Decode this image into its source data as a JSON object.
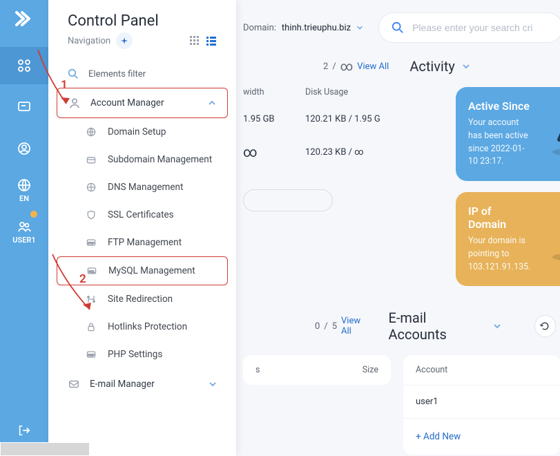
{
  "iconbar": {
    "lang": "EN",
    "user": "USER1"
  },
  "nav": {
    "title": "Control Panel",
    "subtitle": "Navigation",
    "filter_label": "Elements filter",
    "groups": {
      "account": {
        "label": "Account Manager",
        "items": {
          "domain_setup": "Domain Setup",
          "subdomain": "Subdomain Management",
          "dns": "DNS Management",
          "ssl": "SSL Certificates",
          "ftp": "FTP Management",
          "mysql": "MySQL Management",
          "redirect": "Site Redirection",
          "hotlinks": "Hotlinks Protection",
          "php": "PHP Settings"
        }
      },
      "email": {
        "label": "E-mail Manager"
      }
    }
  },
  "top": {
    "domain_label": "Domain:",
    "domain_value": "thinh.trieuphu.biz",
    "search_placeholder": "Please enter your search cri"
  },
  "activity": {
    "pager_numerator": "2",
    "pager_sep": "/",
    "pager_denominator": "∞",
    "pager_link": "View All",
    "title": "Activity"
  },
  "table1": {
    "col_a": "width",
    "col_b": "Disk Usage",
    "r1_a": "1.95 GB",
    "r1_b": "120.21 KB  /  1.95 G",
    "r2_a": "∞",
    "r2_b": "120.23 KB  /  ∞"
  },
  "cards": {
    "active": {
      "title": "Active Since",
      "body": "Your account has been active since 2022-01-10 23:17."
    },
    "ip": {
      "title": "IP of Domain",
      "body": "Your domain is pointing to 103.121.91.135."
    }
  },
  "email_section": {
    "title": "E-mail Accounts",
    "pager_numerator": "0",
    "pager_sep": "/",
    "pager_denominator": "5",
    "pager_link": "View All",
    "col_a": "s",
    "col_b": "Size",
    "col_account": "Account",
    "row_user": "user1",
    "add_new": "+  Add New"
  },
  "annotations": {
    "one": "1",
    "two": "2"
  }
}
